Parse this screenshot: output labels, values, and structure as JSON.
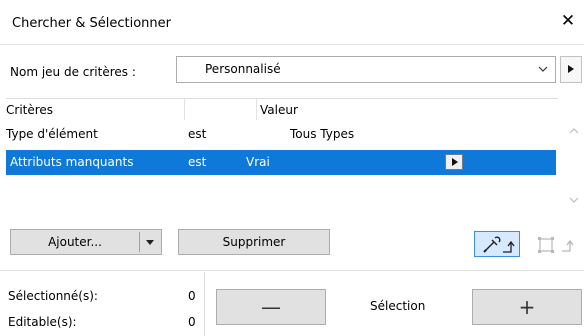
{
  "window": {
    "title": "Chercher & Sélectionner",
    "close_glyph": "✕"
  },
  "criteria_set": {
    "label": "Nom jeu de critères :",
    "value": "Personnalisé"
  },
  "table": {
    "headers": {
      "criteria": "Critères",
      "value": "Valeur"
    },
    "rows": [
      {
        "criterion": "Type d'élément",
        "operator": "est",
        "value": "Tous Types",
        "selected": false
      },
      {
        "criterion": "Attributs manquants",
        "operator": "est",
        "value": "Vrai",
        "selected": true
      }
    ]
  },
  "buttons": {
    "add": "Ajouter...",
    "delete": "Supprimer"
  },
  "icons": {
    "pick": "eyedropper-arrow-icon",
    "frame": "marquee-arrow-icon",
    "close": "close-icon"
  },
  "stats": {
    "selected_label": "Sélectionné(s):",
    "selected_value": "0",
    "editable_label": "Editable(s):",
    "editable_value": "0"
  },
  "selection": {
    "minus": "—",
    "label": "Sélection",
    "plus": "+"
  },
  "colors": {
    "selection_bg": "#0e79d8",
    "button_bg": "#e1e1e1",
    "active_tool_bg": "#d6e9ff"
  }
}
